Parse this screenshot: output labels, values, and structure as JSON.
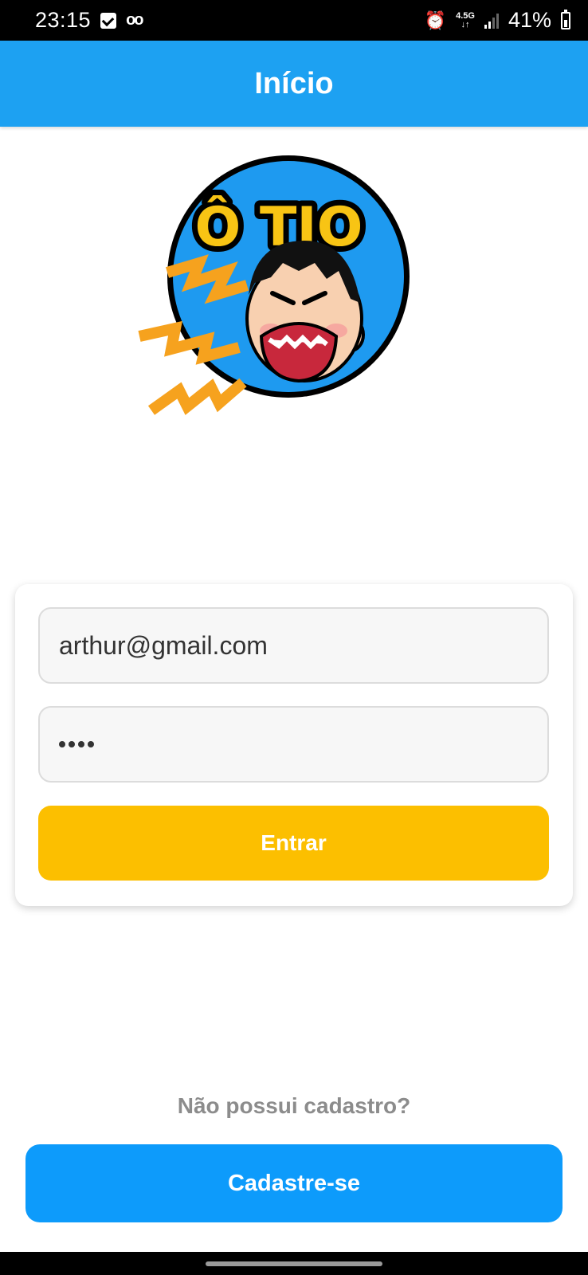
{
  "status_bar": {
    "time": "23:15",
    "network": "4.5G",
    "battery": "41%",
    "icons": [
      "check-square-icon",
      "voicemail-icon",
      "alarm-icon",
      "network-4-5g-icon",
      "signal-icon",
      "battery-icon"
    ]
  },
  "app_bar": {
    "title": "Início"
  },
  "logo": {
    "text": "Ô TIO",
    "icon": "angry-shouting-man-logo"
  },
  "login": {
    "email_value": "arthur@gmail.com",
    "password_value": "••••",
    "submit_label": "Entrar"
  },
  "register": {
    "prompt": "Não possui cadastro?",
    "button_label": "Cadastre-se"
  },
  "colors": {
    "app_bar": "#1da1f2",
    "submit_button": "#fcbf00",
    "register_button": "#0d9bfb",
    "prompt_text": "#8c8c8c"
  }
}
